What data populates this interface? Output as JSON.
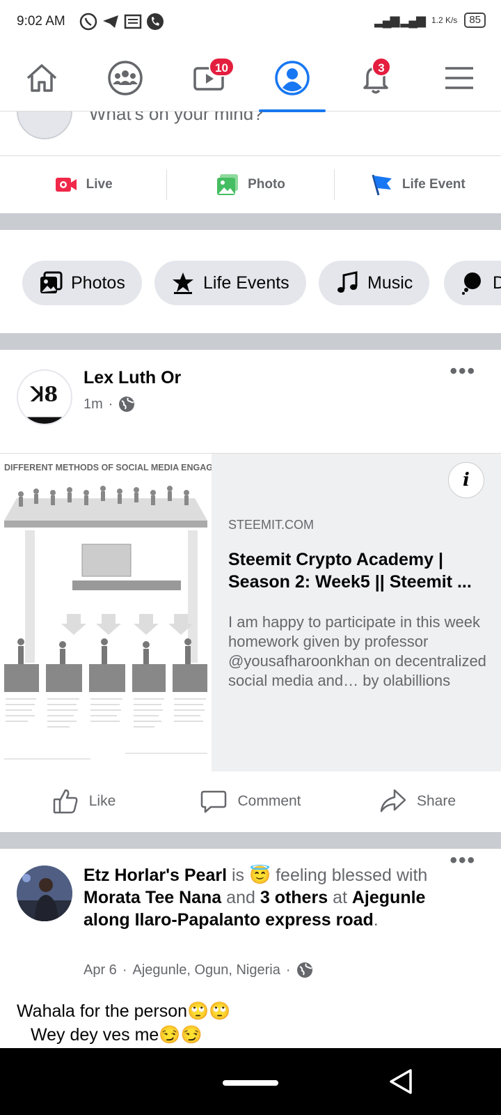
{
  "status_bar": {
    "time": "9:02 AM",
    "speed": "1.2 K/s",
    "battery": "85"
  },
  "tabs": [
    {
      "name": "home"
    },
    {
      "name": "groups"
    },
    {
      "name": "watch",
      "badge": "10"
    },
    {
      "name": "profile"
    },
    {
      "name": "notifications",
      "badge": "3"
    },
    {
      "name": "menu"
    }
  ],
  "composer": {
    "placeholder": "What's on your mind?"
  },
  "composer_actions": [
    {
      "label": "Live",
      "color": "#f02849"
    },
    {
      "label": "Photo",
      "color": "#45bd62"
    },
    {
      "label": "Life Event",
      "color": "#1877f2"
    }
  ],
  "chips": [
    "Photos",
    "Life Events",
    "Music",
    "D"
  ],
  "post1": {
    "author": "Lex Luth Or",
    "time": "1m",
    "link": {
      "image_title": "DIFFERENT METHODS OF SOCIAL MEDIA ENGAGEMENT",
      "domain": "STEEMIT.COM",
      "title": "Steemit Crypto Academy | Season 2: Week5 || Steemit ...",
      "description": "I am happy to participate in this week homework given by professor @yousafharoonkhan on decentralized social media and… by olabillions"
    },
    "actions": [
      "Like",
      "Comment",
      "Share"
    ]
  },
  "post2": {
    "author": "Etz Horlar's Pearl",
    "is": "is",
    "feeling": "feeling blessed",
    "with": "with",
    "tagged": "Morata Tee Nana",
    "and": "and",
    "others": "3 others",
    "at": "at",
    "location": "Ajegunle along Ilaro-Papalanto express road",
    "period": ".",
    "date": "Apr 6",
    "place": "Ajegunle, Ogun, Nigeria",
    "body_line1": "Wahala for the person🙄🙄",
    "body_line2": "Wey dey ves me😏😏"
  }
}
